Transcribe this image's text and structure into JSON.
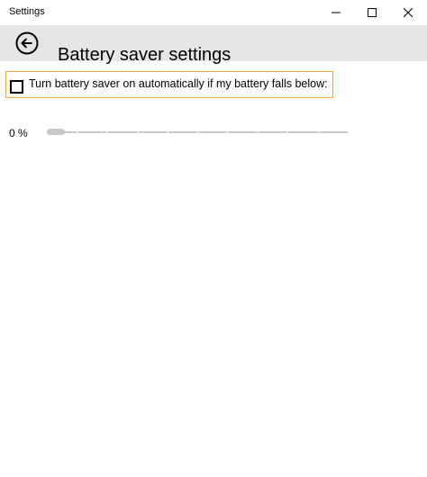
{
  "window": {
    "title": "Settings"
  },
  "header": {
    "title": "Battery saver settings"
  },
  "battery_saver": {
    "auto_on_label": "Turn battery saver on automatically if my battery falls below:",
    "auto_on_checked": false,
    "threshold_text": "0 %",
    "threshold_percent": 0
  },
  "colors": {
    "header_bg": "#e6e6e6",
    "focus_border": "#f0a34a",
    "slider_track": "#cccccc",
    "slider_thumb": "#c8c8c8"
  },
  "icons": {
    "back": "back-arrow-circle-icon",
    "minimize": "minimize-icon",
    "maximize": "maximize-icon",
    "close": "close-icon"
  }
}
